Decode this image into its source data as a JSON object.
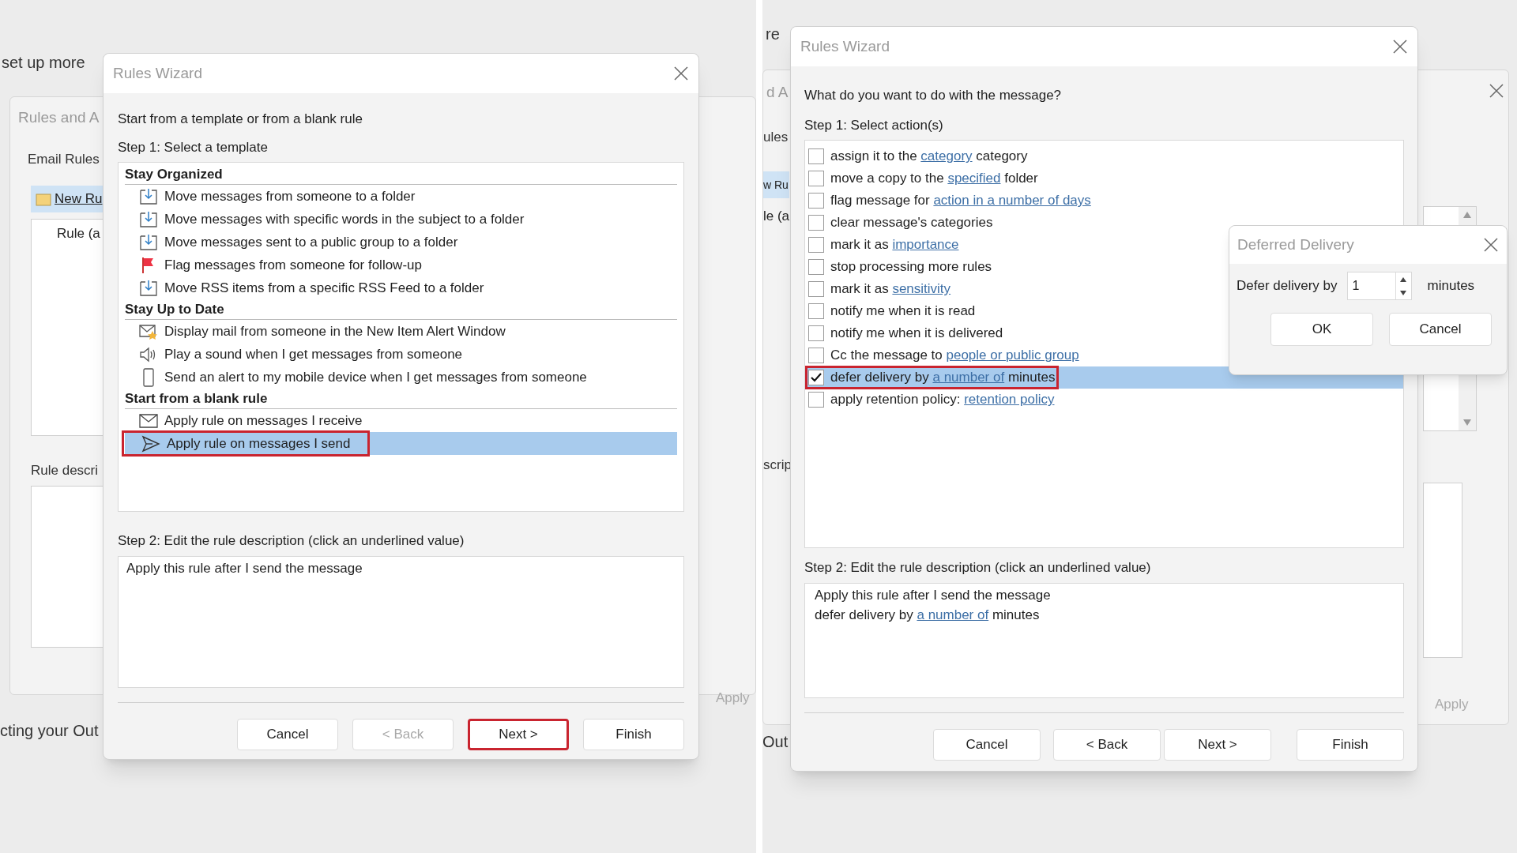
{
  "left_screenshot": {
    "background": {
      "heading_fragment": "set up more",
      "window_title": "Rules and A",
      "tab": "Email Rules",
      "new_rule_button": "New Ru",
      "column_header": "Rule (a",
      "description_label": "Rule descri",
      "footer_fragment": "cting your Out",
      "apply_button": "Apply"
    },
    "wizard": {
      "title": "Rules Wizard",
      "intro": "Start from a template or from a blank rule",
      "step1": "Step 1: Select a template",
      "groups": [
        {
          "heading": "Stay Organized",
          "items": [
            {
              "label": "Move messages from someone to a folder",
              "kind": "move",
              "selected": false,
              "highlighted": false
            },
            {
              "label": "Move messages with specific words in the subject to a folder",
              "kind": "move",
              "selected": false,
              "highlighted": false
            },
            {
              "label": "Move messages sent to a public group to a folder",
              "kind": "move",
              "selected": false,
              "highlighted": false
            },
            {
              "label": "Flag messages from someone for follow-up",
              "kind": "flag",
              "selected": false,
              "highlighted": false
            },
            {
              "label": "Move RSS items from a specific RSS Feed to a folder",
              "kind": "move",
              "selected": false,
              "highlighted": false
            }
          ]
        },
        {
          "heading": "Stay Up to Date",
          "items": [
            {
              "label": "Display mail from someone in the New Item Alert Window",
              "kind": "alert",
              "selected": false,
              "highlighted": false
            },
            {
              "label": "Play a sound when I get messages from someone",
              "kind": "sound",
              "selected": false,
              "highlighted": false
            },
            {
              "label": "Send an alert to my mobile device when I get messages from someone",
              "kind": "mobile",
              "selected": false,
              "highlighted": false
            }
          ]
        },
        {
          "heading": "Start from a blank rule",
          "items": [
            {
              "label": "Apply rule on messages I receive",
              "kind": "envelope",
              "selected": false,
              "highlighted": false
            },
            {
              "label": "Apply rule on messages I send",
              "kind": "send",
              "selected": true,
              "highlighted": true
            }
          ]
        }
      ],
      "step2": "Step 2: Edit the rule description (click an underlined value)",
      "description": [
        [
          {
            "text": "Apply this rule after I send the message",
            "link": false
          }
        ]
      ],
      "buttons": [
        {
          "label": "Cancel",
          "disabled": false,
          "highlighted": false
        },
        {
          "label": "< Back",
          "disabled": true,
          "highlighted": false
        },
        {
          "label": "Next >",
          "disabled": false,
          "highlighted": true
        },
        {
          "label": "Finish",
          "disabled": false,
          "highlighted": false
        }
      ]
    }
  },
  "right_screenshot": {
    "background": {
      "top_fragment": "re",
      "window_title": "d A",
      "label_fragment": "ules",
      "new_rule_button": "w Ru",
      "column_header": "le (a",
      "description_label": "scrip",
      "footer_fragment": "Out",
      "apply_button": "Apply"
    },
    "wizard": {
      "title": "Rules Wizard",
      "question": "What do you want to do with the message?",
      "step1": "Step 1: Select action(s)",
      "actions": [
        {
          "segments": [
            {
              "text": "assign it to the ",
              "link": false
            },
            {
              "text": "category",
              "link": true
            },
            {
              "text": " category",
              "link": false
            }
          ],
          "checked": false,
          "selected": false,
          "highlighted": false
        },
        {
          "segments": [
            {
              "text": "move a copy to the ",
              "link": false
            },
            {
              "text": "specified",
              "link": true
            },
            {
              "text": " folder",
              "link": false
            }
          ],
          "checked": false,
          "selected": false,
          "highlighted": false
        },
        {
          "segments": [
            {
              "text": "flag message for ",
              "link": false
            },
            {
              "text": "action in a number of days",
              "link": true
            }
          ],
          "checked": false,
          "selected": false,
          "highlighted": false
        },
        {
          "segments": [
            {
              "text": "clear message's categories",
              "link": false
            }
          ],
          "checked": false,
          "selected": false,
          "highlighted": false
        },
        {
          "segments": [
            {
              "text": "mark it as ",
              "link": false
            },
            {
              "text": "importance",
              "link": true
            }
          ],
          "checked": false,
          "selected": false,
          "highlighted": false
        },
        {
          "segments": [
            {
              "text": "stop processing more rules",
              "link": false
            }
          ],
          "checked": false,
          "selected": false,
          "highlighted": false
        },
        {
          "segments": [
            {
              "text": "mark it as ",
              "link": false
            },
            {
              "text": "sensitivity",
              "link": true
            }
          ],
          "checked": false,
          "selected": false,
          "highlighted": false
        },
        {
          "segments": [
            {
              "text": "notify me when it is read",
              "link": false
            }
          ],
          "checked": false,
          "selected": false,
          "highlighted": false
        },
        {
          "segments": [
            {
              "text": "notify me when it is delivered",
              "link": false
            }
          ],
          "checked": false,
          "selected": false,
          "highlighted": false
        },
        {
          "segments": [
            {
              "text": "Cc the message to ",
              "link": false
            },
            {
              "text": "people or public group",
              "link": true
            }
          ],
          "checked": false,
          "selected": false,
          "highlighted": false
        },
        {
          "segments": [
            {
              "text": "defer delivery by ",
              "link": false
            },
            {
              "text": "a number of",
              "link": true
            },
            {
              "text": " minutes",
              "link": false
            }
          ],
          "checked": true,
          "selected": true,
          "highlighted": true
        },
        {
          "segments": [
            {
              "text": "apply retention policy: ",
              "link": false
            },
            {
              "text": "retention policy",
              "link": true
            }
          ],
          "checked": false,
          "selected": false,
          "highlighted": false
        }
      ],
      "step2": "Step 2: Edit the rule description (click an underlined value)",
      "description": [
        [
          {
            "text": "Apply this rule after I send the message",
            "link": false
          }
        ],
        [
          {
            "text": "defer delivery by ",
            "link": false
          },
          {
            "text": "a number of",
            "link": true
          },
          {
            "text": " minutes",
            "link": false
          }
        ]
      ],
      "buttons": [
        {
          "label": "Cancel",
          "disabled": false,
          "highlighted": false
        },
        {
          "label": "< Back",
          "disabled": false,
          "highlighted": false
        },
        {
          "label": "Next >",
          "disabled": false,
          "highlighted": false
        },
        {
          "label": "Finish",
          "disabled": false,
          "highlighted": false
        }
      ]
    },
    "deferred_dialog": {
      "title": "Deferred Delivery",
      "label": "Defer delivery by",
      "value": "1",
      "unit": "minutes",
      "buttons": [
        "OK",
        "Cancel"
      ]
    }
  }
}
